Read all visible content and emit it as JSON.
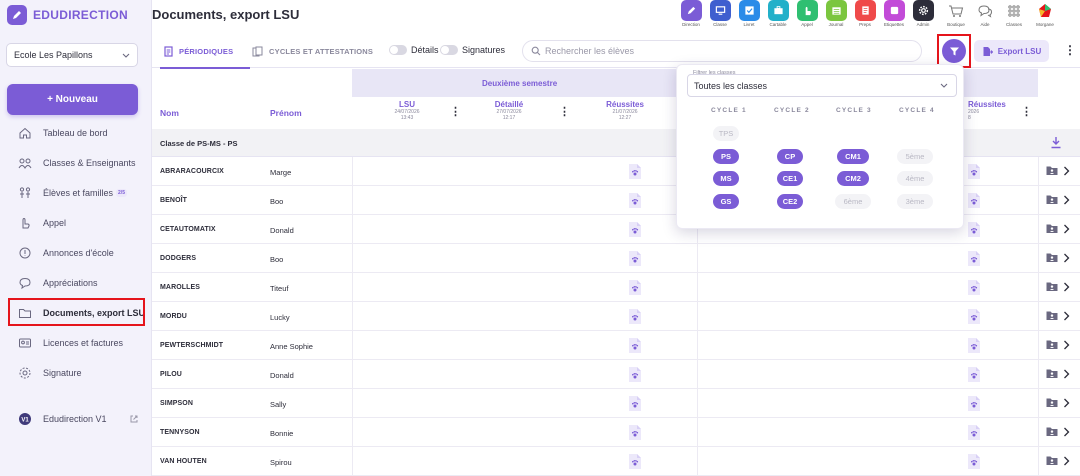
{
  "app": {
    "brand": "EDUDIRECTION",
    "page_title": "Documents, export LSU"
  },
  "sidebar": {
    "school": "Ecole Les Papillons",
    "new_button": "+ Nouveau",
    "items": [
      {
        "label": "Tableau de bord",
        "icon": "home-icon"
      },
      {
        "label": "Classes & Enseignants",
        "icon": "users-icon"
      },
      {
        "label": "Élèves et familles",
        "icon": "family-icon",
        "badge": "2/5"
      },
      {
        "label": "Appel",
        "icon": "hand-icon"
      },
      {
        "label": "Annonces d'école",
        "icon": "megaphone-icon"
      },
      {
        "label": "Appréciations",
        "icon": "speech-bubble-icon"
      },
      {
        "label": "Documents, export LSU",
        "icon": "folder-icon"
      },
      {
        "label": "Licences et factures",
        "icon": "license-icon"
      },
      {
        "label": "Signature",
        "icon": "gear-icon"
      }
    ],
    "v1": {
      "label": "Edudirection V1",
      "badge": "V1"
    }
  },
  "apps": [
    {
      "label": "Direction",
      "color": "#7b5cd6"
    },
    {
      "label": "Classe",
      "color": "#3f5fcf"
    },
    {
      "label": "Livret",
      "color": "#2a8be8"
    },
    {
      "label": "Cartable",
      "color": "#22b0c9"
    },
    {
      "label": "Appel",
      "color": "#2fbf71"
    },
    {
      "label": "Journal",
      "color": "#7bc63f"
    },
    {
      "label": "Preps",
      "color": "#ef4a4a"
    },
    {
      "label": "Etiquettes",
      "color": "#c24bd8"
    },
    {
      "label": "Admin",
      "color": "#2d2d3a"
    },
    {
      "label": "Boutique",
      "color": "#888"
    },
    {
      "label": "Aide",
      "color": "#888"
    },
    {
      "label": "Classes",
      "color": "#888"
    },
    {
      "label": "Morgane",
      "color": "#e5141b"
    }
  ],
  "tabs": [
    {
      "label": "PÉRIODIQUES"
    },
    {
      "label": "CYCLES ET ATTESTATIONS"
    }
  ],
  "toggles": {
    "details": "Détails",
    "signatures": "Signatures"
  },
  "search": {
    "placeholder": "Rechercher les élèves"
  },
  "export_button": "Export LSU",
  "table": {
    "semester": "Deuxième semestre",
    "col_nom": "Nom",
    "col_prenom": "Prénom",
    "columns": [
      {
        "title": "LSU",
        "date": "24/07/2026",
        "time": "13:43"
      },
      {
        "title": "Détaillé",
        "date": "27/07/2026",
        "time": "12:17"
      },
      {
        "title": "Réussites",
        "date": "21/07/2026",
        "time": "12:27"
      },
      {
        "title": "Réussites",
        "date": "2026",
        "time": "8"
      }
    ],
    "group": "Classe de PS-MS - PS",
    "rows": [
      {
        "nom": "ABRARACOURCIX",
        "prenom": "Marge"
      },
      {
        "nom": "BENOÎT",
        "prenom": "Boo"
      },
      {
        "nom": "CETAUTOMATIX",
        "prenom": "Donald"
      },
      {
        "nom": "DODGERS",
        "prenom": "Boo"
      },
      {
        "nom": "MAROLLES",
        "prenom": "Titeuf"
      },
      {
        "nom": "MORDU",
        "prenom": "Lucky"
      },
      {
        "nom": "PEWTERSCHMIDT",
        "prenom": "Anne Sophie"
      },
      {
        "nom": "PILOU",
        "prenom": "Donald"
      },
      {
        "nom": "SIMPSON",
        "prenom": "Sally"
      },
      {
        "nom": "TENNYSON",
        "prenom": "Bonnie"
      },
      {
        "nom": "VAN HOUTEN",
        "prenom": "Spirou"
      }
    ]
  },
  "filter_panel": {
    "label": "Filtrer les classes",
    "selected": "Toutes les classes",
    "cycles": [
      "CYCLE 1",
      "CYCLE 2",
      "CYCLE 3",
      "CYCLE 4"
    ],
    "chips": [
      {
        "label": "TPS",
        "selected": false
      },
      {
        "label": "PS",
        "selected": true
      },
      {
        "label": "MS",
        "selected": true
      },
      {
        "label": "GS",
        "selected": true
      },
      {
        "label": "CP",
        "selected": true
      },
      {
        "label": "CE1",
        "selected": true
      },
      {
        "label": "CE2",
        "selected": true
      },
      {
        "label": "CM1",
        "selected": true
      },
      {
        "label": "CM2",
        "selected": true
      },
      {
        "label": "6ème",
        "selected": false
      },
      {
        "label": "5ème",
        "selected": false
      },
      {
        "label": "4ème",
        "selected": false
      },
      {
        "label": "3ème",
        "selected": false
      }
    ]
  }
}
